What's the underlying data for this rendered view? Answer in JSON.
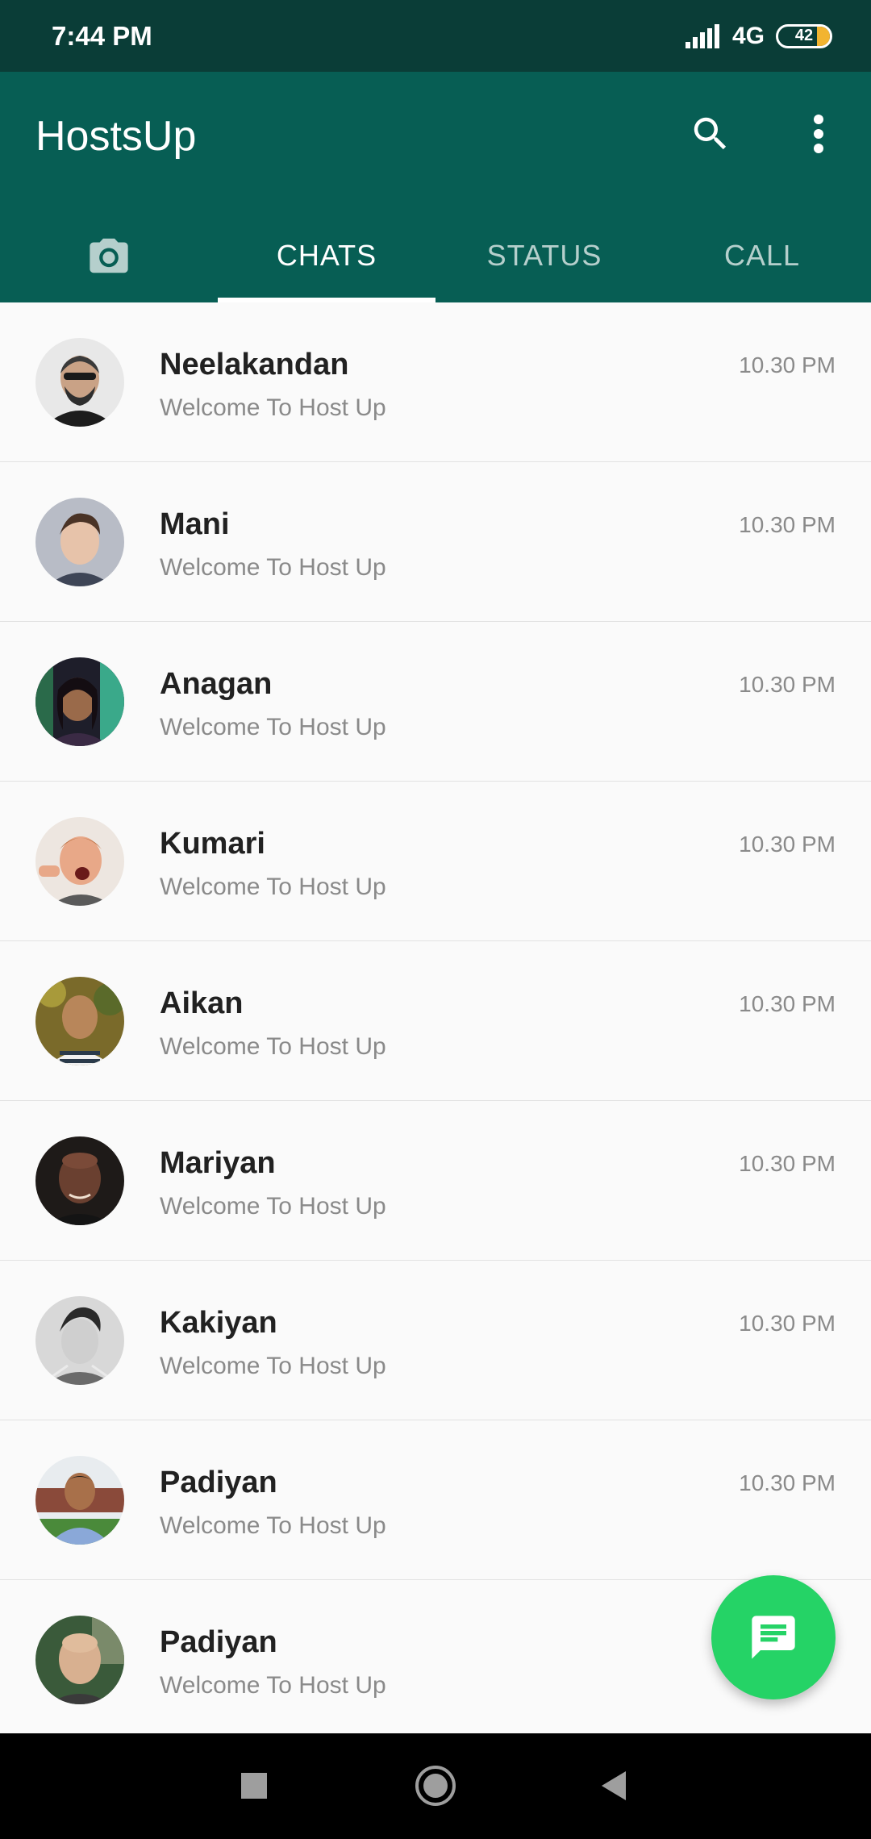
{
  "status_bar": {
    "time": "7:44 PM",
    "network": "4G",
    "battery": "42",
    "icons": [
      "signal-icon",
      "battery-icon"
    ]
  },
  "header": {
    "title": "HostsUp",
    "icons": [
      "search-icon",
      "more-vert-icon"
    ]
  },
  "tabs": [
    {
      "icon": "camera-icon"
    },
    {
      "label": "CHATS",
      "active": true
    },
    {
      "label": "STATUS",
      "active": false
    },
    {
      "label": "CALL",
      "active": false
    }
  ],
  "chats": [
    {
      "name": "Neelakandan",
      "message": "Welcome To Host Up",
      "time": "10.30 PM"
    },
    {
      "name": "Mani",
      "message": "Welcome To Host Up",
      "time": "10.30 PM"
    },
    {
      "name": "Anagan",
      "message": "Welcome To Host Up",
      "time": "10.30 PM"
    },
    {
      "name": "Kumari",
      "message": "Welcome To Host Up",
      "time": "10.30 PM"
    },
    {
      "name": "Aikan",
      "message": "Welcome To Host Up",
      "time": "10.30 PM"
    },
    {
      "name": "Mariyan",
      "message": "Welcome To Host Up",
      "time": "10.30 PM"
    },
    {
      "name": "Kakiyan",
      "message": "Welcome To Host Up",
      "time": "10.30 PM"
    },
    {
      "name": "Padiyan",
      "message": "Welcome To Host Up",
      "time": "10.30 PM"
    },
    {
      "name": "Padiyan",
      "message": "Welcome To Host Up",
      "time": ""
    }
  ],
  "fab": {
    "icon": "message-icon"
  },
  "colors": {
    "status_bar": "#0a3d37",
    "app_bar": "#075e54",
    "fab": "#25d366",
    "name_text": "#212121",
    "secondary_text": "#8a8a8a"
  }
}
